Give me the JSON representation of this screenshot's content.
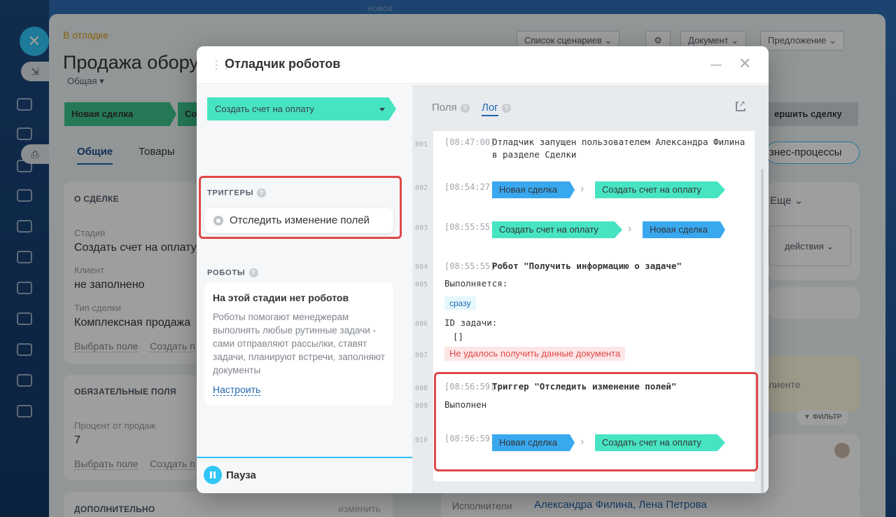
{
  "background": {
    "top_new": "НОВОЕ",
    "status": "В отладке",
    "deal_title": "Продажа обору",
    "category": "Общая",
    "toolbar": {
      "scenarios": "Список сценариев",
      "document": "Документ",
      "offer": "Предложение"
    },
    "stages": [
      "Новая сделка",
      "Со",
      "ершить сделку"
    ],
    "tabs": [
      "Общие",
      "Товары"
    ],
    "bizproc": "знес-процессы",
    "about": {
      "heading": "О СДЕЛКЕ",
      "stage_label": "Стадия",
      "stage_value": "Создать счет на оплату",
      "client_label": "Клиент",
      "client_value": "не заполнено",
      "type_label": "Тип сделки",
      "type_value": "Комплексная продажа",
      "select_field": "Выбрать поле",
      "create_field": "Создать п"
    },
    "required": {
      "heading": "ОБЯЗАТЕЛЬНЫЕ ПОЛЯ",
      "percent_label": "Процент от продаж",
      "percent_value": "7",
      "select_field": "Выбрать поле",
      "create_field": "Создать п"
    },
    "extra": {
      "heading": "ДОПОЛНИТЕЛЬНО",
      "edit": "изменить"
    },
    "right": {
      "more": "Еще",
      "actions": "действия",
      "client": "лиенте",
      "filter": "ФИЛЬТР"
    },
    "assignees_label": "Исполнители",
    "assignees_value": "Александра Филина, Лена Петрова"
  },
  "modal": {
    "title": "Отладчик роботов",
    "stage_select": "Создать счет на оплату",
    "triggers_heading": "ТРИГГЕРЫ",
    "trigger_item": "Отследить изменение полей",
    "robots_heading": "РОБОТЫ",
    "robots_empty_title": "На этой стадии нет роботов",
    "robots_empty_text": "Роботы помогают менеджерам выполнять любые рутинные задачи - сами отправляют рассылки, ставят задачи, планируют встречи, заполняют документы",
    "robots_setup": "Настроить",
    "pause": "Пауза",
    "tabs": {
      "fields": "Поля",
      "log": "Лог"
    },
    "log": {
      "l001": {
        "n": "001",
        "ts": "[08:47:00]",
        "text": "Отладчик запущен пользователем Александра Филина в разделе Сделки"
      },
      "l002": {
        "n": "002",
        "ts": "[08:54:27]",
        "from": "Новая сделка",
        "to": "Создать счет на оплату"
      },
      "l003": {
        "n": "003",
        "ts": "[08:55:55]",
        "from": "Создать счет на оплату",
        "to": "Новая сделка"
      },
      "l004": {
        "n": "004",
        "ts": "[08:55:55]",
        "text": "Робот \"Получить информацию о задаче\""
      },
      "l005": {
        "n": "005",
        "text": "Выполняется:",
        "badge": "сразу"
      },
      "l006": {
        "n": "006",
        "text": "ID задачи:",
        "value": "[]"
      },
      "l007": {
        "n": "007",
        "error": "Не удалось получить данные документа"
      },
      "l008": {
        "n": "008",
        "ts": "[08:56:59]",
        "text": "Триггер \"Отследить изменение полей\""
      },
      "l009": {
        "n": "009",
        "text": "Выполнен"
      },
      "l010": {
        "n": "010",
        "ts": "[08:56:59]",
        "from": "Новая сделка",
        "to": "Создать счет на оплату"
      }
    }
  }
}
